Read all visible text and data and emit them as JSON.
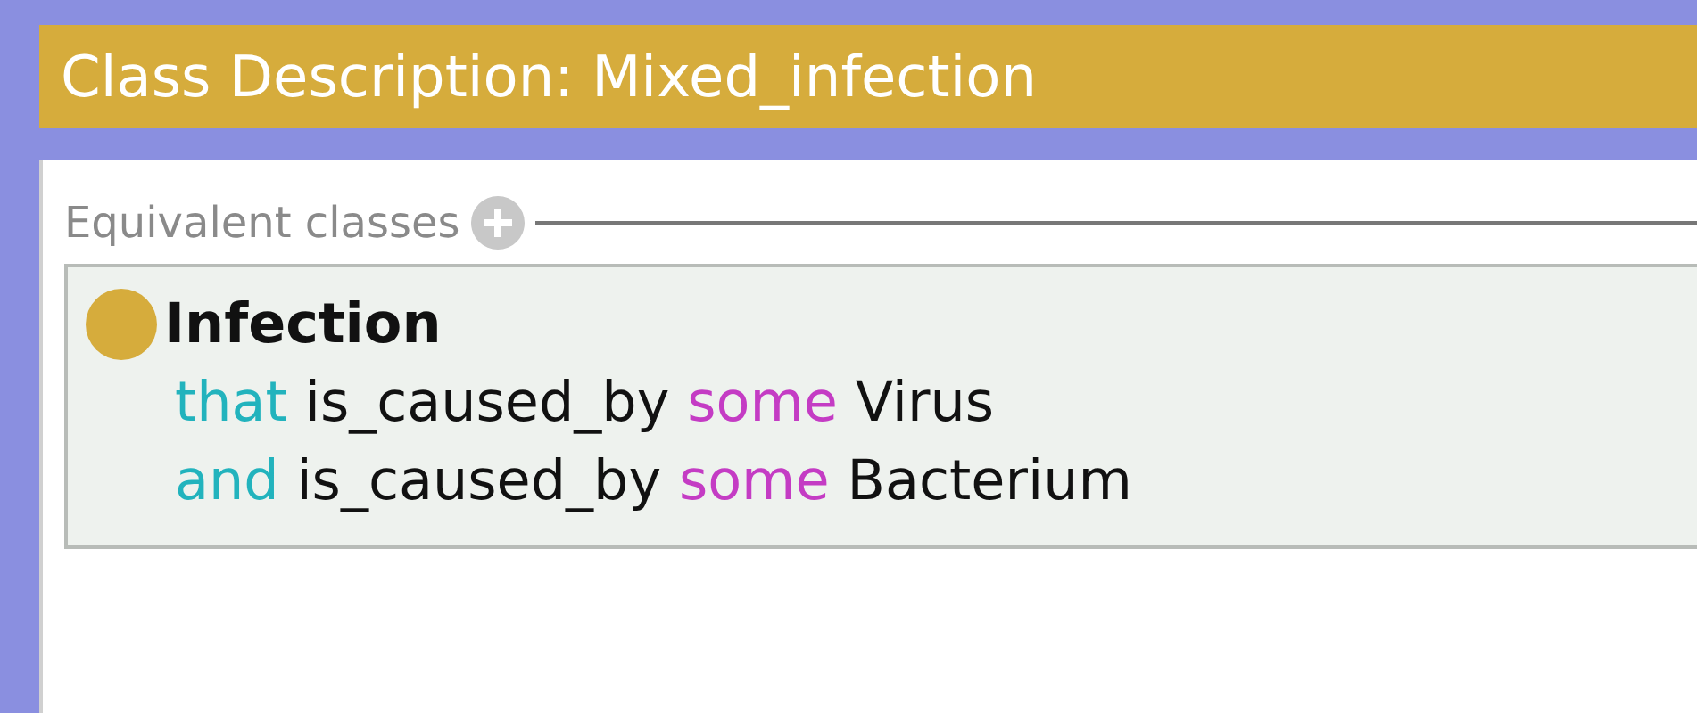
{
  "title": "Class Description: Mixed_infection",
  "section": {
    "label": "Equivalent classes"
  },
  "expression": {
    "head": "Infection",
    "lines": [
      [
        {
          "kind": "keyword",
          "text": "that"
        },
        {
          "kind": "property",
          "text": "is_caused_by"
        },
        {
          "kind": "quantifier",
          "text": "some"
        },
        {
          "kind": "class",
          "text": "Virus"
        }
      ],
      [
        {
          "kind": "keyword",
          "text": "and"
        },
        {
          "kind": "property",
          "text": "is_caused_by"
        },
        {
          "kind": "quantifier",
          "text": "some"
        },
        {
          "kind": "class",
          "text": "Bacterium"
        }
      ]
    ]
  }
}
